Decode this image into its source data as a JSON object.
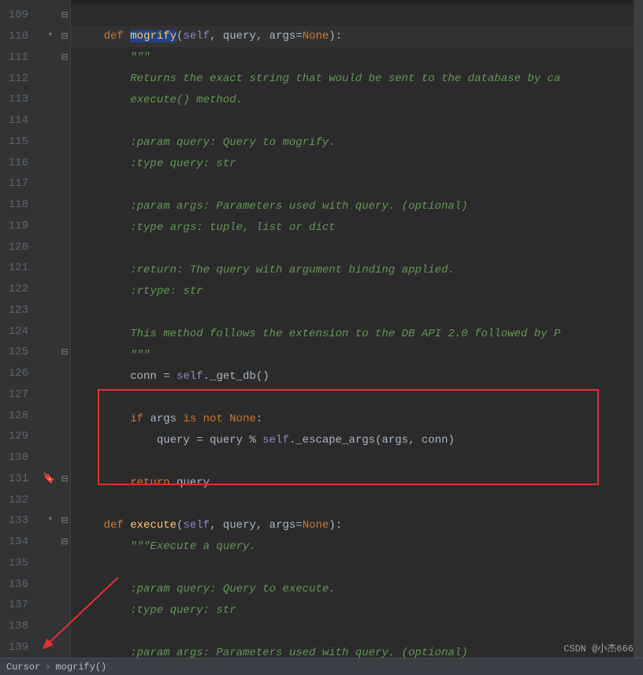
{
  "lines": [
    {
      "n": 109,
      "mod": "",
      "fold": ""
    },
    {
      "n": 110,
      "mod": "*",
      "fold": "open"
    },
    {
      "n": 111,
      "mod": "",
      "fold": "open"
    },
    {
      "n": 112,
      "mod": "",
      "fold": ""
    },
    {
      "n": 113,
      "mod": "",
      "fold": ""
    },
    {
      "n": 114,
      "mod": "",
      "fold": ""
    },
    {
      "n": 115,
      "mod": "",
      "fold": ""
    },
    {
      "n": 116,
      "mod": "",
      "fold": ""
    },
    {
      "n": 117,
      "mod": "",
      "fold": ""
    },
    {
      "n": 118,
      "mod": "",
      "fold": ""
    },
    {
      "n": 119,
      "mod": "",
      "fold": ""
    },
    {
      "n": 120,
      "mod": "",
      "fold": ""
    },
    {
      "n": 121,
      "mod": "",
      "fold": ""
    },
    {
      "n": 122,
      "mod": "",
      "fold": ""
    },
    {
      "n": 123,
      "mod": "",
      "fold": ""
    },
    {
      "n": 124,
      "mod": "",
      "fold": ""
    },
    {
      "n": 125,
      "mod": "",
      "fold": "close"
    },
    {
      "n": 126,
      "mod": "",
      "fold": ""
    },
    {
      "n": 127,
      "mod": "",
      "fold": ""
    },
    {
      "n": 128,
      "mod": "",
      "fold": ""
    },
    {
      "n": 129,
      "mod": "",
      "fold": ""
    },
    {
      "n": 130,
      "mod": "",
      "fold": ""
    },
    {
      "n": 131,
      "mod": "",
      "fold": "close",
      "bookmark": true
    },
    {
      "n": 132,
      "mod": "",
      "fold": ""
    },
    {
      "n": 133,
      "mod": "*",
      "fold": "open"
    },
    {
      "n": 134,
      "mod": "",
      "fold": "open"
    },
    {
      "n": 135,
      "mod": "",
      "fold": ""
    },
    {
      "n": 136,
      "mod": "",
      "fold": ""
    },
    {
      "n": 137,
      "mod": "",
      "fold": ""
    },
    {
      "n": 138,
      "mod": "",
      "fold": ""
    },
    {
      "n": 139,
      "mod": "",
      "fold": ""
    }
  ],
  "code": {
    "l110": {
      "kw": "def",
      "fn": "mogrify",
      "s": "self",
      "c": ", query, args=",
      "none": "None",
      "p": "):",
      "indent": "    "
    },
    "l111": {
      "txt": "        \"\"\""
    },
    "l112": {
      "txt": "        Returns the exact string that would be sent to the database by ca"
    },
    "l113": {
      "txt": "        execute() method."
    },
    "l114": {
      "txt": ""
    },
    "l115": {
      "txt": "        :param query: Query to mogrify."
    },
    "l116": {
      "txt": "        :type query: str"
    },
    "l117": {
      "txt": ""
    },
    "l118": {
      "txt": "        :param args: Parameters used with query. (optional)"
    },
    "l119": {
      "txt": "        :type args: tuple, list or dict"
    },
    "l120": {
      "txt": ""
    },
    "l121": {
      "txt": "        :return: The query with argument binding applied."
    },
    "l122": {
      "txt": "        :rtype: str"
    },
    "l123": {
      "txt": ""
    },
    "l124": {
      "txt": "        This method follows the extension to the DB API 2.0 followed by P"
    },
    "l125": {
      "txt": "        \"\"\""
    },
    "l126": {
      "pre": "        conn = ",
      "self": "self",
      "post": "._get_db()"
    },
    "l127": {
      "txt": ""
    },
    "l128": {
      "pre": "        ",
      "if": "if ",
      "args": "args ",
      "isnot": "is not ",
      "none": "None",
      "colon": ":"
    },
    "l129": {
      "pre": "            query = query % ",
      "self": "self",
      "post": "._escape_args(args, conn)"
    },
    "l130": {
      "txt": ""
    },
    "l131": {
      "pre": "        ",
      "ret": "return ",
      "q": "query"
    },
    "l132": {
      "txt": ""
    },
    "l133": {
      "kw": "def",
      "fn": "execute",
      "s": "self",
      "c": ", query, args=",
      "none": "None",
      "p": "):",
      "indent": "    "
    },
    "l134": {
      "txt": "        \"\"\"Execute a query."
    },
    "l135": {
      "txt": ""
    },
    "l136": {
      "txt": "        :param query: Query to execute."
    },
    "l137": {
      "txt": "        :type query: str"
    },
    "l138": {
      "txt": ""
    },
    "l139": {
      "txt": "        :param args: Parameters used with query. (optional)"
    }
  },
  "breadcrumb": {
    "c1": "Cursor",
    "c2": "mogrify()"
  },
  "watermark": "CSDN @小杰666"
}
